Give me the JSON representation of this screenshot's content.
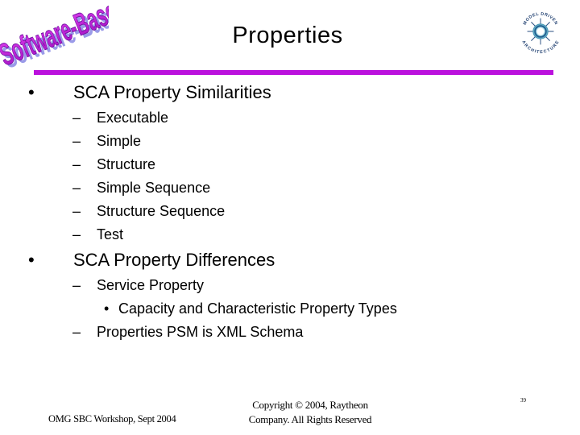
{
  "header": {
    "logo_left_text": "Software-Based",
    "logo_right": {
      "top_text": "MODEL DRIVEN",
      "bottom_text": "ARCHITECTURE"
    },
    "title": "Properties",
    "accent_color": "#bb11dd"
  },
  "body": {
    "sections": [
      {
        "heading": "SCA Property Similarities",
        "bullet": "•",
        "items": [
          {
            "dash": "–",
            "text": "Executable"
          },
          {
            "dash": "–",
            "text": "Simple"
          },
          {
            "dash": "–",
            "text": "Structure"
          },
          {
            "dash": "–",
            "text": "Simple Sequence"
          },
          {
            "dash": "–",
            "text": "Structure Sequence"
          },
          {
            "dash": "–",
            "text": "Test"
          }
        ]
      },
      {
        "heading": "SCA Property Differences",
        "bullet": "•",
        "items": [
          {
            "dash": "–",
            "text": "Service Property",
            "sub": [
              {
                "dot": "•",
                "text": "Capacity and Characteristic Property Types"
              }
            ]
          },
          {
            "dash": "–",
            "text": "Properties PSM is XML Schema"
          }
        ]
      }
    ]
  },
  "footer": {
    "left": "OMG SBC Workshop, Sept 2004",
    "center_line1": "Copyright © 2004, Raytheon",
    "center_line2": "Company. All Rights Reserved",
    "slide_number": "39"
  }
}
